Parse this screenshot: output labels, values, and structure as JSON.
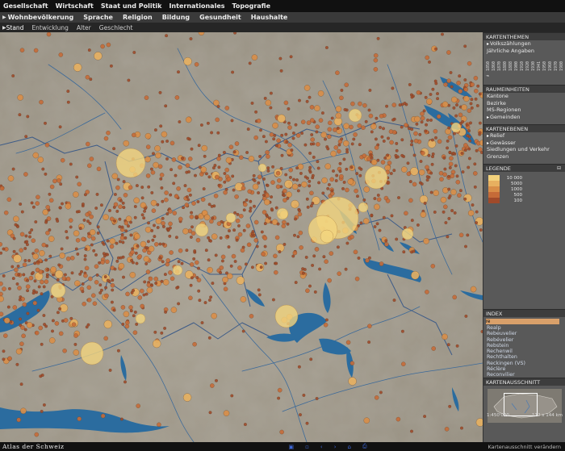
{
  "app": {
    "brand": "Atlas der Schweiz",
    "status": "Kartenausschnitt verändern"
  },
  "menu_primary": [
    "Gesellschaft",
    "Wirtschaft",
    "Staat und Politik",
    "Internationales",
    "Topografie"
  ],
  "menu_secondary": [
    "Wohnbevölkerung",
    "Sprache",
    "Religion",
    "Bildung",
    "Gesundheit",
    "Haushalte"
  ],
  "menu_tertiary": [
    "Stand",
    "Entwicklung",
    "Alter",
    "Geschlecht"
  ],
  "panel": {
    "kartenthemen": {
      "title": "KARTENTHEMEN",
      "items": [
        "Volkszählungen",
        "Jährliche Angaben"
      ],
      "selected_index": 0,
      "years": [
        "1850",
        "1860",
        "1870",
        "1880",
        "1888",
        "1900",
        "1910",
        "1920",
        "1930",
        "1941",
        "1950",
        "1960",
        "1970",
        "1980",
        "1990",
        "2000"
      ],
      "selected_year": "2000"
    },
    "raumeinheiten": {
      "title": "RAUMEINHEITEN",
      "items": [
        "Kantone",
        "Bezirke",
        "MS-Regionen",
        "Gemeinden"
      ],
      "selected_index": 3
    },
    "kartenebenen": {
      "title": "KARTENEBENEN",
      "items": [
        "Relief",
        "Gewässer",
        "Siedlungen und Verkehr",
        "Grenzen"
      ],
      "checked": [
        true,
        true,
        false,
        false
      ]
    },
    "legende": {
      "title": "LEGENDE",
      "classes": [
        {
          "label": "100",
          "color": "#a04a2a"
        },
        {
          "label": "500",
          "color": "#c56b38"
        },
        {
          "label": "1000",
          "color": "#d88e48"
        },
        {
          "label": "5000",
          "color": "#e7b060"
        },
        {
          "label": "10 000",
          "color": "#f3d27c"
        }
      ]
    },
    "index": {
      "title": "INDEX",
      "query": "re",
      "items": [
        "Realp",
        "Rebeuvelier",
        "Rebévelier",
        "Rebstein",
        "Rechenwil",
        "Rechthalten",
        "Reckingen (VS)",
        "Réclère",
        "Reconvilier"
      ]
    },
    "ausschnitt": {
      "title": "KARTENAUSSCHNITT",
      "scale": "1:450'000",
      "extent": "172 x 144 km"
    }
  },
  "map": {
    "colors": {
      "land": "#a29b8d",
      "water": "#2b6c9f",
      "border": "#405f8c",
      "river": "#3c6a9a"
    },
    "symbol_classes": [
      {
        "min": 0,
        "color": "#a04a2a"
      },
      {
        "min": 500,
        "color": "#c56b38"
      },
      {
        "min": 1000,
        "color": "#d88e48"
      },
      {
        "min": 5000,
        "color": "#e7b060"
      },
      {
        "min": 10000,
        "color": "#f3d27c"
      }
    ]
  }
}
